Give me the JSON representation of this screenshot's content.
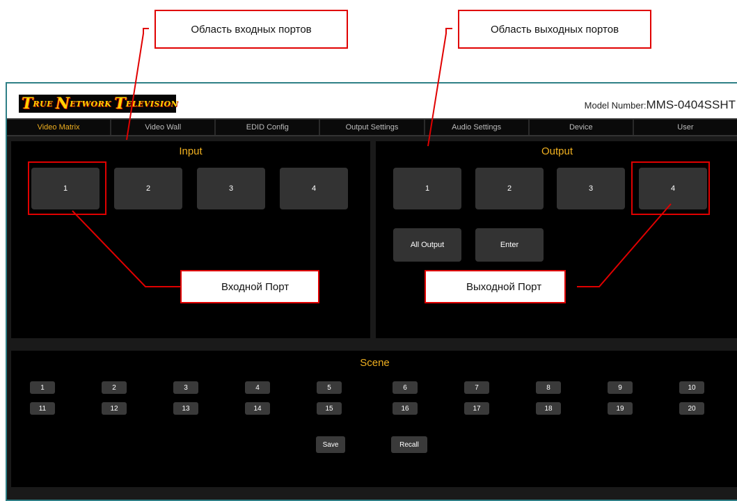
{
  "annotations": {
    "input_area": "Область входных портов",
    "output_area": "Область выходных портов",
    "input_port": "Входной Порт",
    "output_port": "Выходной Порт",
    "highlight_color": "#e00000"
  },
  "header": {
    "logo": {
      "w1_cap": "T",
      "w1_rest": "RUE",
      "w2_cap": "N",
      "w2_rest": "ETWORK",
      "w3_cap": "T",
      "w3_rest": "ELEVISION"
    },
    "model_label": "Model Number:",
    "model_value": "MMS-0404SSHT"
  },
  "nav": {
    "items": [
      "Video Matrix",
      "Video Wall",
      "EDID Config",
      "Output Settings",
      "Audio Settings",
      "Device",
      "User"
    ],
    "active": "Video Matrix",
    "active_color": "#f0b020"
  },
  "input": {
    "title": "Input",
    "ports": [
      "1",
      "2",
      "3",
      "4"
    ]
  },
  "output": {
    "title": "Output",
    "ports": [
      "1",
      "2",
      "3",
      "4"
    ],
    "all_output": "All Output",
    "enter": "Enter"
  },
  "scene": {
    "title": "Scene",
    "row1": [
      "1",
      "2",
      "3",
      "4",
      "5",
      "6",
      "7",
      "8",
      "9",
      "10"
    ],
    "row2": [
      "11",
      "12",
      "13",
      "14",
      "15",
      "16",
      "17",
      "18",
      "19",
      "20"
    ],
    "save": "Save",
    "recall": "Recall"
  }
}
